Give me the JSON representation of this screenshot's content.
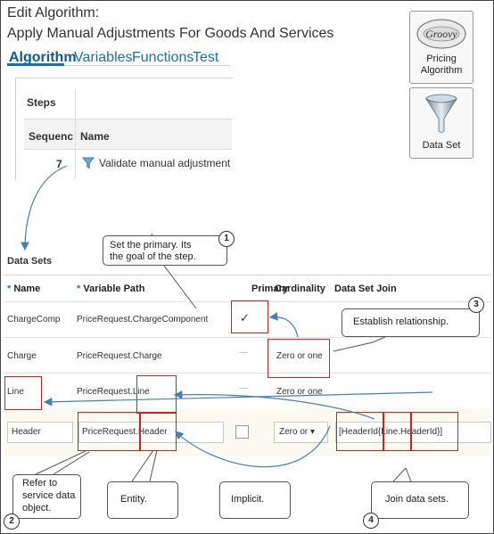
{
  "header": {
    "title_line1": "Edit Algorithm:",
    "title_line2": "Apply Manual Adjustments For Goods And Services"
  },
  "tabs": [
    {
      "label": "Algorithm",
      "active": true
    },
    {
      "label": "Variables",
      "active": false
    },
    {
      "label": "Functions",
      "active": false
    },
    {
      "label": "Test",
      "active": false
    }
  ],
  "side_buttons": {
    "pricing_algorithm": {
      "logo_text": "Groovy",
      "label_line1": "Pricing",
      "label_line2": "Algorithm"
    },
    "data_set": {
      "label": "Data Set",
      "icon": "funnel-icon"
    }
  },
  "steps": {
    "title": "Steps",
    "columns": {
      "sequence": "Sequenc",
      "name": "Name"
    },
    "rows": [
      {
        "sequence": "7",
        "name": "Validate manual adjustment",
        "icon": "funnel-icon"
      }
    ]
  },
  "data_sets": {
    "title": "Data Sets",
    "columns": {
      "required_mark": "*",
      "name": "Name",
      "variable_path": "Variable Path",
      "primary": "Primary",
      "cardinality": "Cardinality",
      "data_set_join": "Data Set Join"
    },
    "rows": [
      {
        "name": "ChargeComp",
        "variable_path": "PriceRequest.ChargeComponent",
        "primary": "✓",
        "cardinality": "",
        "join": ""
      },
      {
        "name": "Charge",
        "variable_path": "PriceRequest.Charge",
        "primary": "—",
        "cardinality": "Zero or one",
        "join": ""
      },
      {
        "name": "Line",
        "variable_path_prefix": "PriceRequest.",
        "variable_path_entity": "Line",
        "primary": "—",
        "cardinality": "Zero or one",
        "join": ""
      }
    ],
    "edit_row": {
      "name": "Header",
      "path_prefix": "PriceRequest.",
      "path_entity": "Header",
      "cardinality": "Zero or",
      "cardinality_arrow": "▾",
      "join_part1": "[HeaderId",
      "join_part2": "{Line.",
      "join_part3": "HeaderId}]"
    }
  },
  "callouts": {
    "c1": {
      "number": "1",
      "text_line1": "Set the primary. Its",
      "text_line2": "the goal of the step."
    },
    "c2": {
      "number": "2",
      "text_line1": "Refer to",
      "text_line2": "service data",
      "text_line3": "object."
    },
    "c3": {
      "number": "3",
      "text": "Establish relationship."
    },
    "c4": {
      "number": "4",
      "text": "Join data sets."
    },
    "entity": {
      "text": "Entity."
    },
    "implicit": {
      "text": "Implicit."
    }
  },
  "colors": {
    "link": "#1a6fb0",
    "highlight_box": "#d42020",
    "arrow": "#4a7fb5"
  }
}
